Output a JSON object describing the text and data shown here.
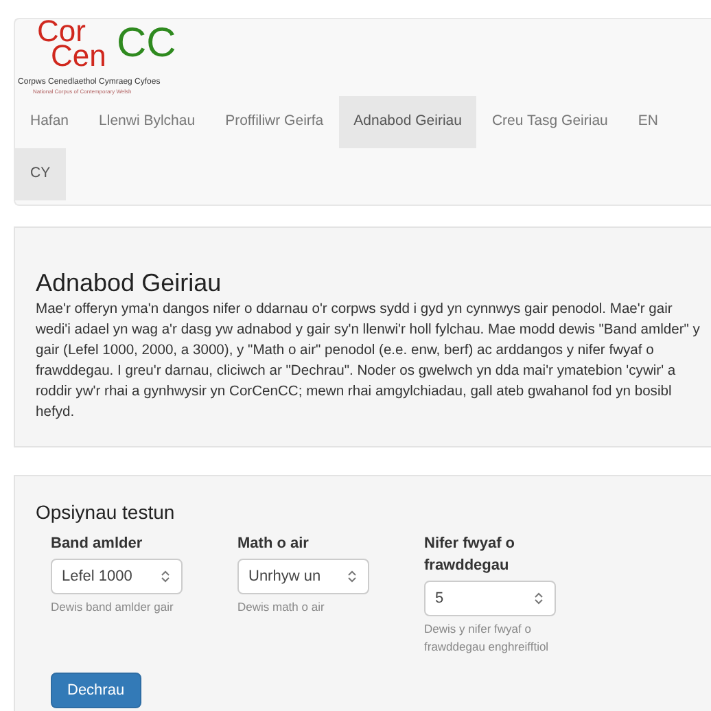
{
  "logo": {
    "parts": [
      {
        "text": "Cor",
        "color": "#d0281e"
      },
      {
        "text": "Cen",
        "color": "#d0281e"
      },
      {
        "text": "CC",
        "color": "#2f8a1f"
      }
    ],
    "title": "Corpws Cenedlaethol Cymraeg Cyfoes",
    "subtitle": "National Corpus of Contemporary Welsh"
  },
  "nav": [
    {
      "label": "Hafan",
      "selected": false
    },
    {
      "label": "Llenwi Bylchau",
      "selected": false
    },
    {
      "label": "Proffiliwr Geirfa",
      "selected": false
    },
    {
      "label": "Adnabod Geiriau",
      "selected": true
    },
    {
      "label": "Creu Tasg Geiriau",
      "selected": false
    },
    {
      "label": "EN",
      "selected": false
    },
    {
      "label": "CY",
      "selected": true
    }
  ],
  "intro": {
    "title": "Adnabod Geiriau",
    "body": "Mae'r offeryn yma'n dangos nifer o ddarnau o'r corpws sydd i gyd yn cynnwys gair penodol. Mae'r gair wedi'i adael yn wag a'r dasg yw adnabod y gair sy'n llenwi'r holl fylchau. Mae modd dewis \"Band amlder\" y gair (Lefel 1000, 2000, a 3000), y \"Math o air\" penodol (e.e. enw, berf) ac arddangos y nifer fwyaf o frawddegau. I greu'r darnau, cliciwch ar \"Dechrau\". Noder os gwelwch yn dda mai'r ymatebion 'cywir' a roddir yw'r rhai a gynhwysir yn CorCenCC; mewn rhai amgylchiadau, gall ateb gwahanol fod yn bosibl hefyd."
  },
  "options": {
    "title": "Opsiynau testun",
    "fields": [
      {
        "label": "Band amlder",
        "value": "Lefel 1000",
        "help": "Dewis band amlder gair"
      },
      {
        "label": "Math o air",
        "value": "Unrhyw un",
        "help": "Dewis math o air"
      },
      {
        "label": "Nifer fwyaf o frawddegau",
        "value": "5",
        "help": "Dewis y nifer fwyaf o frawddegau enghreifftiol"
      }
    ],
    "button": "Dechrau"
  }
}
